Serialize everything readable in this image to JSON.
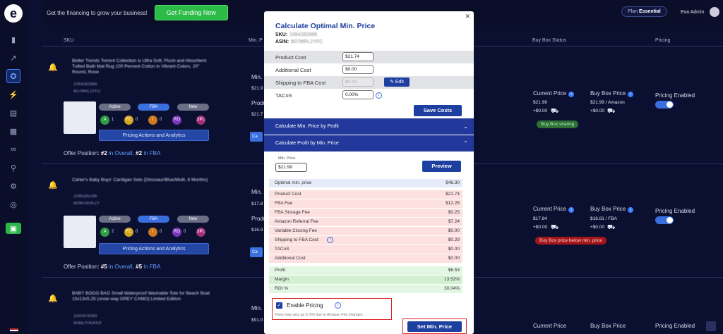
{
  "sidebar": {
    "logo": "e",
    "icons": [
      "chart-bar-icon",
      "trend-icon",
      "award-icon",
      "bolt-icon",
      "document-icon",
      "truck-icon",
      "link-icon",
      "search-icon",
      "gear-icon",
      "support-icon",
      "money-icon"
    ]
  },
  "topbar": {
    "promo": "Get the financing to grow your business!",
    "funding_button": "Get Funding Now",
    "plan_prefix": "Plan",
    "plan_name": "Essential",
    "user_name": "Eva Admin"
  },
  "table": {
    "headers": {
      "sku": "SKU",
      "min_price": "Min. P",
      "buy_box_status": "Buy Box Status",
      "pricing": "Pricing"
    },
    "rows": [
      {
        "title": "Better Trends Torrent Collection is Ultra Soft, Plush and Absorbent Tufted Bath Mat Rug 100 Percent Cotton in Vibrant Colors, 20\" Round, Rose",
        "sku": "1064282888",
        "asin": "B07MRL2YFC",
        "badges": [
          "Active",
          "FBA",
          "New"
        ],
        "counts": [
          {
            "label": "A",
            "value": "1",
            "color": "#2e9e44"
          },
          {
            "label": "FC",
            "value": "0",
            "color": "#d6a520"
          },
          {
            "label": "I",
            "value": "0",
            "color": "#d07a20"
          },
          {
            "label": "RO",
            "value": "",
            "color": "#7b35b8"
          },
          {
            "label": "3PL",
            "value": "",
            "color": "#a4307a"
          }
        ],
        "actions": "Pricing Actions and Analytics",
        "offer_prefix": "Offer Position:",
        "offer_overall": "#2",
        "offer_overall_text": "in Overall,",
        "offer_fba": "#2",
        "offer_fba_text": "in FBA",
        "min_price_label": "Min. P",
        "min_price_val": "$21.9",
        "product_label": "Product",
        "product_val": "$21.7",
        "current_price_label": "Current Price",
        "current_price_val": "$21.99",
        "current_ship": "+$0.00",
        "bb_price_label": "Buy Box Price",
        "bb_price_val": "$21.99 / Amazon",
        "bb_ship": "+$0.00",
        "status": "Buy Box sharing",
        "status_type": "green",
        "pricing_label": "Pricing Enabled",
        "pricing_on": true
      },
      {
        "title": "Carter's Baby Boys' Cardigan Sets (Dinosaur/Blue/Multi, 6 Months)",
        "sku": "1046285286",
        "asin": "B09HJ9SKZY",
        "badges": [
          "Active",
          "FBA",
          "New"
        ],
        "counts": [
          {
            "label": "A",
            "value": "2",
            "color": "#2e9e44"
          },
          {
            "label": "FC",
            "value": "0",
            "color": "#d6a520"
          },
          {
            "label": "I",
            "value": "0",
            "color": "#d07a20"
          },
          {
            "label": "RO",
            "value": "0",
            "color": "#7b35b8"
          },
          {
            "label": "3PL",
            "value": "",
            "color": "#a4307a"
          }
        ],
        "actions": "Pricing Actions and Analytics",
        "offer_prefix": "Offer Position:",
        "offer_overall": "#5",
        "offer_overall_text": "in Overall,",
        "offer_fba": "#5",
        "offer_fba_text": "in FBA",
        "min_price_label": "Min. P",
        "min_price_val": "$17.8",
        "product_label": "Product",
        "product_val": "$16.9",
        "current_price_label": "Current Price",
        "current_price_val": "$17.84",
        "current_ship": "+$0.00",
        "bb_price_label": "Buy Box Price",
        "bb_price_val": "$16.81 / FBA",
        "bb_ship": "+$0.00",
        "status": "Buy Box price below min. price",
        "status_type": "red",
        "pricing_label": "Pricing Enabled",
        "pricing_on": true
      },
      {
        "title": "BABY BOGG BAG Small Waterproof Washable Tote for Beach Boat 15x13x5.25 (snow way GREY CAMO) Limited Edition",
        "sku": "1050479083",
        "asin": "B0BEYHDKK9",
        "min_price_label": "Min. P",
        "min_price_val": "$91.0",
        "current_price_label": "Current Price",
        "bb_price_label": "Buy Box Price",
        "pricing_label": "Pricing Enabled"
      }
    ]
  },
  "modal": {
    "title": "Calculate Optimal Min. Price",
    "sku_label": "SKU:",
    "sku_value": "1064282888",
    "asin_label": "ASIN:",
    "asin_value": "B07MRL2YFC",
    "costs": [
      {
        "label": "Product Cost",
        "value": "$21.74",
        "disabled": false
      },
      {
        "label": "Additional Cost",
        "value": "$0.00",
        "disabled": false
      },
      {
        "label": "Shipping to FBA Cost",
        "value": "$0.29",
        "disabled": true
      },
      {
        "label": "TACoS",
        "value": "0.00%",
        "disabled": false
      }
    ],
    "edit_button": "Edit",
    "save_button": "Save Costs",
    "section1": "Calculate Min. Price by Profit",
    "section2": "Calculate Profit by Min. Price",
    "min_price_label": "Min. Price",
    "min_price_value": "$21.99",
    "preview_button": "Preview",
    "results": [
      {
        "label": "Optimal min. price",
        "value": "$48.30",
        "tone": "blue",
        "info": false
      },
      {
        "label": "Product Cost",
        "value": "$21.74",
        "tone": "pink",
        "info": false
      },
      {
        "label": "FBA Fee",
        "value": "$12.25",
        "tone": "pink",
        "info": false
      },
      {
        "label": "FBA Storage Fee",
        "value": "$0.25",
        "tone": "pink",
        "info": false
      },
      {
        "label": "Amazon Referral Fee",
        "value": "$7.24",
        "tone": "pink",
        "info": false
      },
      {
        "label": "Variable Closing Fee",
        "value": "$0.00",
        "tone": "pink",
        "info": false
      },
      {
        "label": "Shipping to FBA Cost",
        "value": "$0.29",
        "tone": "pink",
        "info": true
      },
      {
        "label": "TACoS",
        "value": "$0.00",
        "tone": "pink",
        "info": false
      },
      {
        "label": "Additional Cost",
        "value": "$0.00",
        "tone": "pink",
        "info": false
      },
      {
        "label": "Profit",
        "value": "$6.53",
        "tone": "green",
        "info": false
      },
      {
        "label": "Margin",
        "value": "13.52%",
        "tone": "green2",
        "info": false
      },
      {
        "label": "ROI %",
        "value": "30.04%",
        "tone": "green",
        "info": false
      }
    ],
    "enable_label": "Enable Pricing",
    "fee_note": "Fees may vary up to 5% due to Amazon Fee changes.",
    "set_button": "Set Min. Price"
  },
  "colors": {
    "page_bg": "#0c1030",
    "accent": "#1d3fa0",
    "funding_green": "#2cbb47",
    "highlight_red": "#dd2222"
  }
}
